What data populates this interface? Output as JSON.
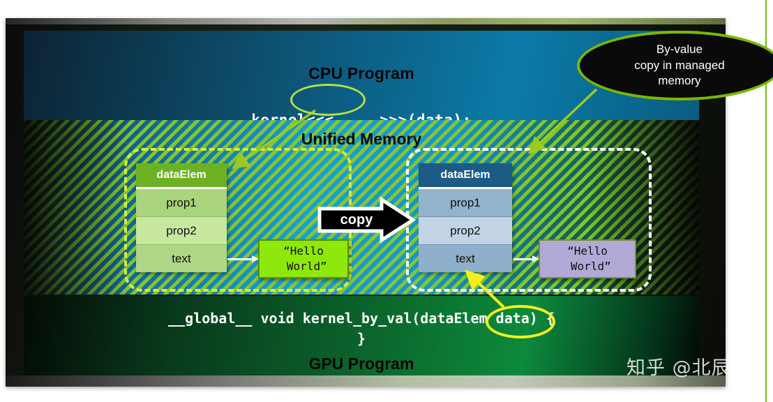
{
  "slide": {
    "cpu": {
      "title": "CPU Program",
      "code": "kernel<<< ... >>>(data);"
    },
    "unified_memory": {
      "title": "Unified Memory"
    },
    "gpu": {
      "title": "GPU Program",
      "code": "__global__ void kernel_by_val(dataElem data) {\n}"
    },
    "struct_left": {
      "header": "dataElem",
      "rows": [
        "prop1",
        "prop2",
        "text"
      ],
      "value_box": "“Hello\n World”"
    },
    "struct_right": {
      "header": "dataElem",
      "rows": [
        "prop1",
        "prop2",
        "text"
      ],
      "value_box": "“Hello\n World”"
    },
    "copy_arrow_label": "copy",
    "callout": "By-value\ncopy in managed\nmemory",
    "watermark": "知乎 @北辰"
  },
  "colors": {
    "accent_green": "#7ab800",
    "highlight_yellow": "#f5ef1e",
    "struct_left_header": "#6cb124",
    "struct_right_header": "#1c5b86",
    "hello_left_bg": "#8fe80c",
    "hello_right_bg": "#b3a9d6"
  }
}
